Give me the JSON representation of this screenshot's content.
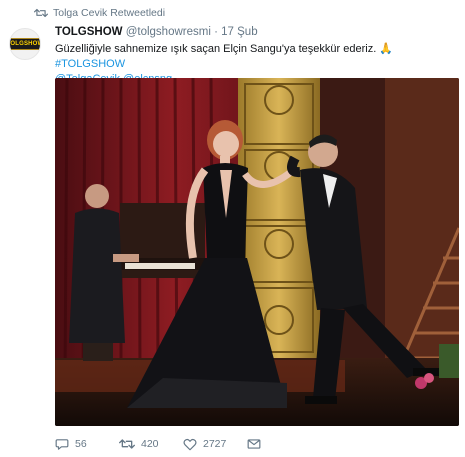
{
  "retweet_notice": "Tolga Cevik Retweetledi",
  "avatar": {
    "logo_text": "TOLGSHOW"
  },
  "tweet": {
    "name": "TOLGSHOW",
    "handle": "@tolgshowresmi",
    "separator": "·",
    "time": "17 Şub",
    "text_main": "Güzelliğiyle sahnemize ışık saçan Elçin Sangu'ya teşekkür ederiz.",
    "emoji": "🙏",
    "hashtag": "#TOLGSHOW",
    "mention_1": "@TolgaCevik",
    "mention_2": "@elcnsng"
  },
  "actions": {
    "reply_count": "56",
    "retweet_count": "420",
    "like_count": "2727"
  },
  "icons": {
    "retweet_notice": "retweet-icon",
    "reply": "reply-icon",
    "retweet": "retweet-icon",
    "like": "heart-icon",
    "dm": "envelope-icon"
  },
  "colors": {
    "link": "#1b95e0",
    "muted": "#657786",
    "text": "#14171a"
  }
}
